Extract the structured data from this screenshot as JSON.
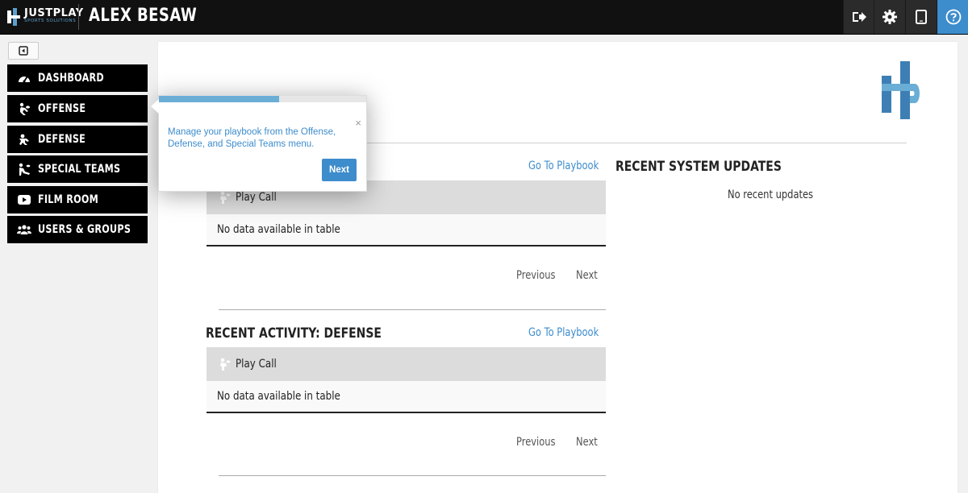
{
  "brand": {
    "name": "JUSTPLAY",
    "tagline": "SPORTS SOLUTIONS"
  },
  "header": {
    "user_name": "ALEX BESAW"
  },
  "toolbar": {
    "icons": [
      "logout-icon",
      "gear-icon",
      "tablet-icon",
      "help-icon"
    ]
  },
  "sidebar": {
    "items": [
      {
        "label": "DASHBOARD",
        "icon": "dashboard-icon"
      },
      {
        "label": "OFFENSE",
        "icon": "offense-icon"
      },
      {
        "label": "DEFENSE",
        "icon": "defense-icon"
      },
      {
        "label": "SPECIAL TEAMS",
        "icon": "special-teams-icon"
      },
      {
        "label": "FILM ROOM",
        "icon": "video-icon"
      },
      {
        "label": "USERS & GROUPS",
        "icon": "users-icon"
      }
    ]
  },
  "popover": {
    "message": "Manage your playbook from the Offense, Defense, and Special Teams menu.",
    "close": "×",
    "next_label": "Next",
    "progress_fraction": 0.58
  },
  "offense_activity": {
    "link": "Go To Playbook",
    "column": "Play Call",
    "empty": "No data available in table",
    "prev": "Previous",
    "next": "Next"
  },
  "defense_activity": {
    "title": "RECENT ACTIVITY: DEFENSE",
    "link": "Go To Playbook",
    "column": "Play Call",
    "empty": "No data available in table",
    "prev": "Previous",
    "next": "Next"
  },
  "system_updates": {
    "title": "RECENT SYSTEM UPDATES",
    "empty": "No recent updates"
  },
  "colors": {
    "accent": "#3d8ccc",
    "topbar": "#111111",
    "nav": "#000000"
  }
}
